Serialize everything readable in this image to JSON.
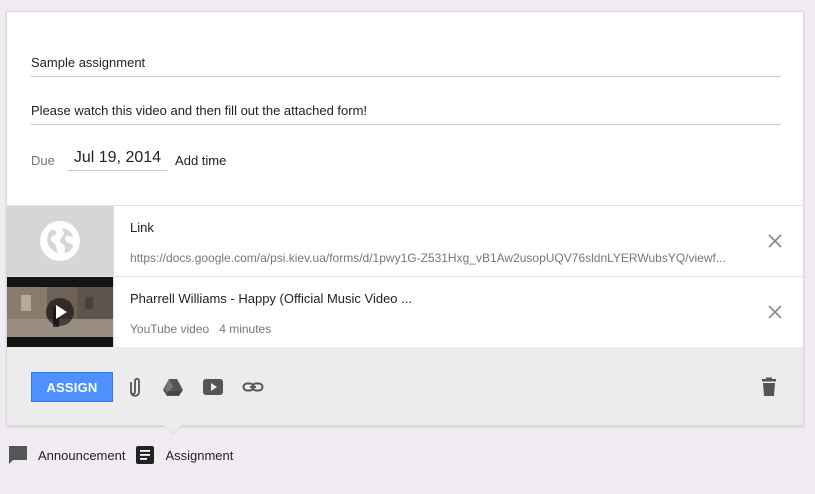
{
  "form": {
    "title": "Sample assignment",
    "description": "Please watch this video and then fill out the attached form!",
    "due_label": "Due",
    "due_date": "Jul 19, 2014",
    "add_time": "Add time"
  },
  "attachments": [
    {
      "type": "link",
      "icon": "globe-icon",
      "title": "Link",
      "subtitle": "https://docs.google.com/a/psi.kiev.ua/forms/d/1pwy1G-Z531Hxg_vB1Aw2usopUQV76sldnLYERWubsYQ/viewf..."
    },
    {
      "type": "video",
      "icon": "play-icon",
      "title": "Pharrell Williams - Happy (Official Music Video ...",
      "subtitle": "YouTube video",
      "duration": "4 minutes"
    }
  ],
  "toolbar": {
    "assign_label": "ASSIGN",
    "icons": [
      "paperclip-icon",
      "google-drive-icon",
      "youtube-icon",
      "link-icon",
      "trash-icon"
    ]
  },
  "tabs": [
    {
      "label": "Announcement",
      "icon": "comment-icon"
    },
    {
      "label": "Assignment",
      "icon": "assignment-icon"
    }
  ],
  "colors": {
    "assign_button": "#4d90fe",
    "toolbar_bg": "#ececec",
    "page_bg": "#f1ecf3"
  }
}
